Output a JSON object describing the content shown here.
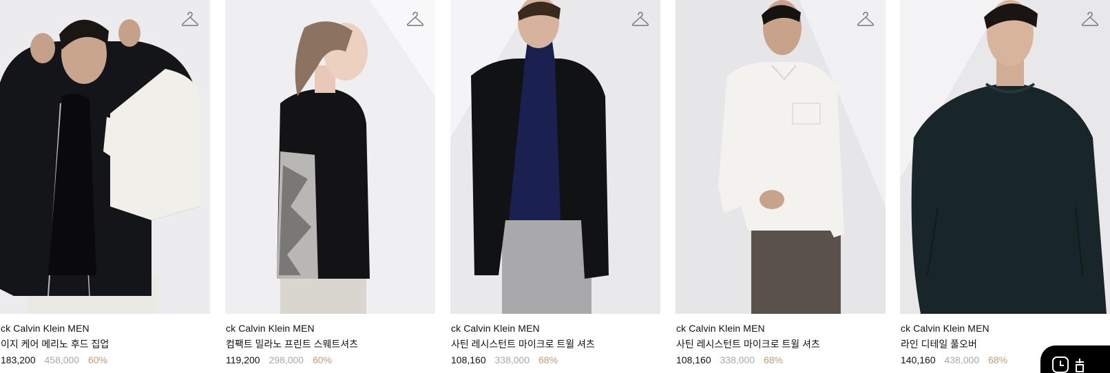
{
  "products": [
    {
      "brand": "ck Calvin Klein MEN",
      "name": "이지 케어 메리노 후드 집업",
      "price": "183,200",
      "original_price": "458,000",
      "discount": "60%"
    },
    {
      "brand": "ck Calvin Klein MEN",
      "name": "컴팩트 밀라노 프린트 스웨트셔츠",
      "price": "119,200",
      "original_price": "298,000",
      "discount": "60%"
    },
    {
      "brand": "ck Calvin Klein MEN",
      "name": "사틴 레시스턴트 마이크로 트윌 셔츠",
      "price": "108,160",
      "original_price": "338,000",
      "discount": "68%"
    },
    {
      "brand": "ck Calvin Klein MEN",
      "name": "사틴 레시스턴트 마이크로 트윌 셔츠",
      "price": "108,160",
      "original_price": "338,000",
      "discount": "68%"
    },
    {
      "brand": "ck Calvin Klein MEN",
      "name": "라인 디테일 풀오버",
      "price": "140,160",
      "original_price": "438,000",
      "discount": "68%"
    }
  ],
  "icons": {
    "wishlist": "hanger-icon",
    "floating": "clock-icon"
  },
  "colors": {
    "discount": "#c89a72",
    "original_price": "#a8a8a8",
    "text": "#111111"
  }
}
